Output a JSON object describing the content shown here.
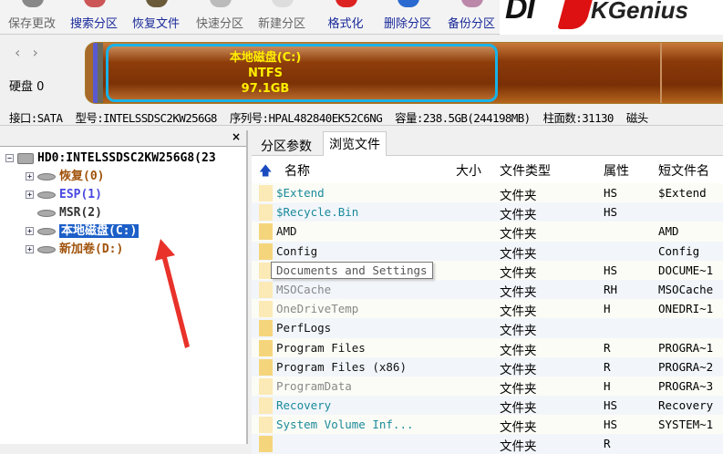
{
  "toolbar": {
    "buttons": [
      {
        "label": "保存更改",
        "color": "#666",
        "icon": "#888"
      },
      {
        "label": "搜索分区",
        "color": "#1a2a9a",
        "icon": "#c55"
      },
      {
        "label": "恢复文件",
        "color": "#1a2a9a",
        "icon": "#6a5a3a"
      },
      {
        "label": "快速分区",
        "color": "#666",
        "icon": "#bbb"
      },
      {
        "label": "新建分区",
        "color": "#666",
        "icon": "#ddd"
      },
      {
        "label": "格式化",
        "color": "#1a2a9a",
        "icon": "#d22"
      },
      {
        "label": "删除分区",
        "color": "#1a2a9a",
        "icon": "#2a6ad0"
      },
      {
        "label": "备份分区",
        "color": "#1a2a9a",
        "icon": "#b8a"
      }
    ],
    "logo": "DiskGenius"
  },
  "disk": {
    "nav": "‹ ›",
    "label": "硬盘 0",
    "selected_partition": {
      "name": "本地磁盘(C:)",
      "fs": "NTFS",
      "size": "97.1GB"
    }
  },
  "info": {
    "items": [
      "接口:SATA",
      "型号:INTELSSDSC2KW256G8",
      "序列号:HPAL482840EK52C6NG",
      "容量:238.5GB(244198MB)",
      "柱面数:31130",
      "磁头"
    ]
  },
  "tree": {
    "close": "×",
    "root": "HD0:INTELSSDSC2KW256G8(23",
    "nodes": [
      {
        "label": "恢复(0)",
        "color": "#a0520a",
        "expand": "+"
      },
      {
        "label": "ESP(1)",
        "color": "#4848e0",
        "expand": "+"
      },
      {
        "label": "MSR(2)",
        "color": "#333",
        "expand": ""
      },
      {
        "label": "本地磁盘(C:)",
        "color": "#fff",
        "expand": "+",
        "selected": true
      },
      {
        "label": "新加卷(D:)",
        "color": "#a0520a",
        "expand": "+"
      }
    ]
  },
  "tabs": [
    "分区参数",
    "浏览文件"
  ],
  "columns": {
    "name": "名称",
    "size": "大小",
    "type": "文件类型",
    "attr": "属性",
    "short": "短文件名"
  },
  "files": [
    {
      "name": "$Extend",
      "type": "文件夹",
      "attr": "HS",
      "short": "$Extend",
      "color": "#1a8a9a",
      "on": false
    },
    {
      "name": "$Recycle.Bin",
      "type": "文件夹",
      "attr": "HS",
      "short": "",
      "color": "#1a8a9a",
      "on": false
    },
    {
      "name": "AMD",
      "type": "文件夹",
      "attr": "",
      "short": "AMD",
      "color": "#111",
      "on": true
    },
    {
      "name": "Config",
      "type": "文件夹",
      "attr": "",
      "short": "Config",
      "color": "#111",
      "on": true
    },
    {
      "name": "",
      "type": "文件夹",
      "attr": "HS",
      "short": "DOCUME~1",
      "color": "#888",
      "on": false
    },
    {
      "name": "MSOCache",
      "type": "文件夹",
      "attr": "RH",
      "short": "MSOCache",
      "color": "#888",
      "on": false
    },
    {
      "name": "OneDriveTemp",
      "type": "文件夹",
      "attr": "H",
      "short": "ONEDRI~1",
      "color": "#888",
      "on": false
    },
    {
      "name": "PerfLogs",
      "type": "文件夹",
      "attr": "",
      "short": "",
      "color": "#111",
      "on": true
    },
    {
      "name": "Program Files",
      "type": "文件夹",
      "attr": "R",
      "short": "PROGRA~1",
      "color": "#111",
      "on": true
    },
    {
      "name": "Program Files (x86)",
      "type": "文件夹",
      "attr": "R",
      "short": "PROGRA~2",
      "color": "#111",
      "on": true
    },
    {
      "name": "ProgramData",
      "type": "文件夹",
      "attr": "H",
      "short": "PROGRA~3",
      "color": "#888",
      "on": false
    },
    {
      "name": "Recovery",
      "type": "文件夹",
      "attr": "HS",
      "short": "Recovery",
      "color": "#1a8a9a",
      "on": false
    },
    {
      "name": "System Volume Inf...",
      "type": "文件夹",
      "attr": "HS",
      "short": "SYSTEM~1",
      "color": "#1a8a9a",
      "on": false
    },
    {
      "name": "",
      "type": "文件夹",
      "attr": "R",
      "short": "",
      "color": "#111",
      "on": true
    }
  ],
  "tooltip": "Documents and Settings",
  "colors": {
    "annotation_arrow": "#e8322a",
    "selection": "#1c5fc8",
    "partition_border": "#17b3e8"
  }
}
